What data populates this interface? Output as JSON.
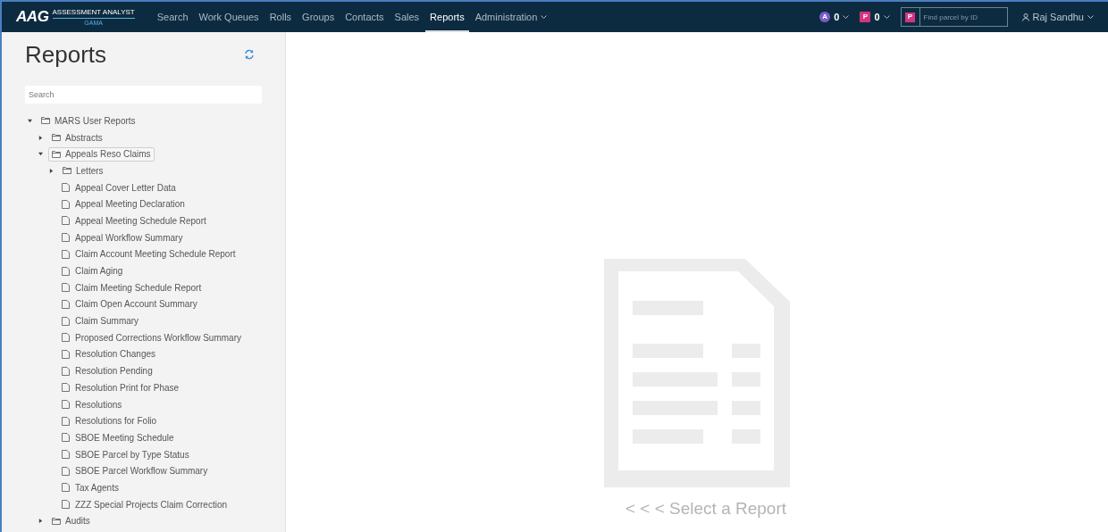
{
  "header": {
    "logo": {
      "mark": "AAG",
      "line1": "ASSESSMENT ANALYST",
      "line2": "GAMA"
    },
    "nav": [
      {
        "label": "Search",
        "selected": false
      },
      {
        "label": "Work Queues",
        "selected": false
      },
      {
        "label": "Rolls",
        "selected": false
      },
      {
        "label": "Groups",
        "selected": false
      },
      {
        "label": "Contacts",
        "selected": false
      },
      {
        "label": "Sales",
        "selected": false
      },
      {
        "label": "Reports",
        "selected": true
      },
      {
        "label": "Administration",
        "selected": false,
        "dropdown": true
      }
    ],
    "counters": [
      {
        "kind": "circle",
        "letter": "A",
        "count": "0",
        "color": "#7a5cc9"
      },
      {
        "kind": "square",
        "letter": "P",
        "count": "0",
        "color": "#d6337f"
      }
    ],
    "parcel_search": {
      "letter": "P",
      "placeholder": "Find parcel by ID"
    },
    "user": "Raj Sandhu"
  },
  "sidebar": {
    "title": "Reports",
    "search": {
      "placeholder": "Search"
    },
    "tree": [
      {
        "kind": "folder",
        "label": "MARS User Reports",
        "expanded": true,
        "selected": false,
        "children": [
          {
            "kind": "folder",
            "label": "Abstracts",
            "expanded": false,
            "selected": false
          },
          {
            "kind": "folder",
            "label": "Appeals Reso Claims",
            "expanded": true,
            "selected": true,
            "children": [
              {
                "kind": "folder",
                "label": "Letters",
                "expanded": false,
                "selected": false
              },
              {
                "kind": "report",
                "label": "Appeal Cover Letter Data"
              },
              {
                "kind": "report",
                "label": "Appeal Meeting Declaration"
              },
              {
                "kind": "report",
                "label": "Appeal Meeting Schedule Report"
              },
              {
                "kind": "report",
                "label": "Appeal Workflow Summary"
              },
              {
                "kind": "report",
                "label": "Claim Account Meeting Schedule Report"
              },
              {
                "kind": "report",
                "label": "Claim Aging"
              },
              {
                "kind": "report",
                "label": "Claim Meeting Schedule Report"
              },
              {
                "kind": "report",
                "label": "Claim Open Account Summary"
              },
              {
                "kind": "report",
                "label": "Claim Summary"
              },
              {
                "kind": "report",
                "label": "Proposed Corrections Workflow Summary"
              },
              {
                "kind": "report",
                "label": "Resolution Changes"
              },
              {
                "kind": "report",
                "label": "Resolution Pending"
              },
              {
                "kind": "report",
                "label": "Resolution Print for Phase"
              },
              {
                "kind": "report",
                "label": "Resolutions"
              },
              {
                "kind": "report",
                "label": "Resolutions for Folio"
              },
              {
                "kind": "report",
                "label": "SBOE Meeting Schedule"
              },
              {
                "kind": "report",
                "label": "SBOE Parcel by Type Status"
              },
              {
                "kind": "report",
                "label": "SBOE Parcel Workflow Summary"
              },
              {
                "kind": "report",
                "label": "Tax Agents"
              },
              {
                "kind": "report",
                "label": "ZZZ Special Projects Claim Correction"
              }
            ]
          },
          {
            "kind": "folder",
            "label": "Audits",
            "expanded": false,
            "selected": false
          }
        ]
      }
    ]
  },
  "main": {
    "empty_message": "< < < Select a Report"
  }
}
